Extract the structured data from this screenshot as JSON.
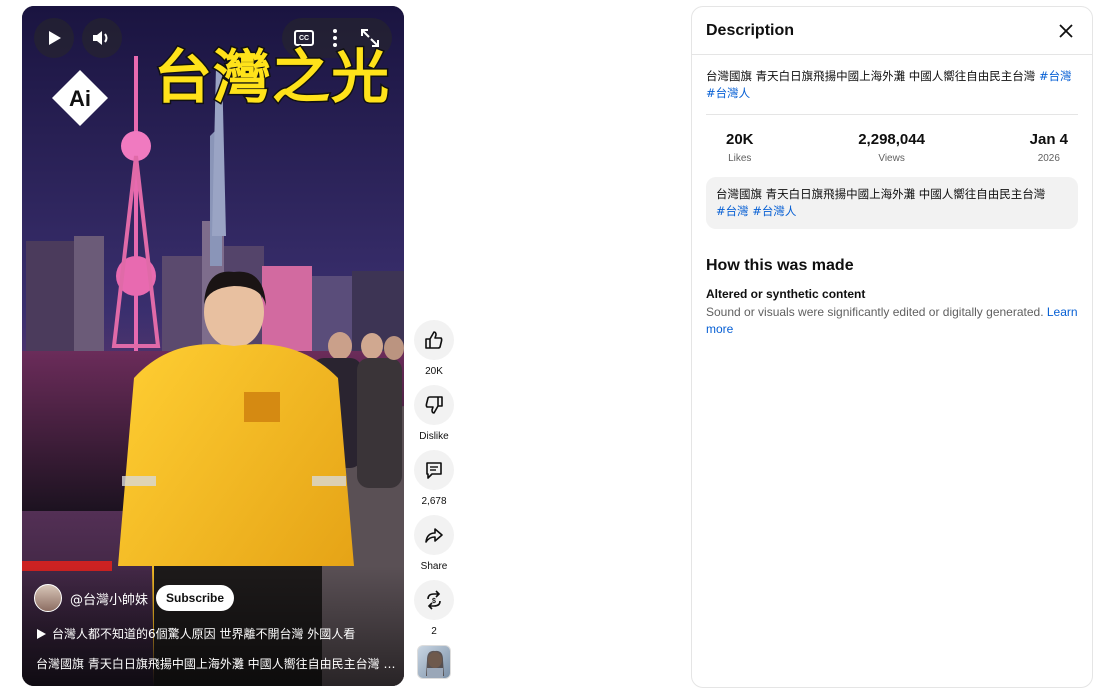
{
  "player": {
    "overlay_title": "台灣之光",
    "ai_badge": "Ai",
    "channel": "@台灣小帥妹",
    "subscribe_label": "Subscribe",
    "related_title": "台灣人都不知道的6個驚人原因 世界離不開台灣 外國人看",
    "caption": "台灣國旗 青天白日旗飛揚中國上海外灘 中國人嚮往自由民主台灣 #...",
    "icons": {
      "play": "play-icon",
      "volume": "volume-icon",
      "cc": "captions-icon",
      "more": "more-vert-icon",
      "fullscreen": "fullscreen-icon"
    }
  },
  "actions": {
    "like_count": "20K",
    "dislike_label": "Dislike",
    "comment_count": "2,678",
    "share_label": "Share",
    "remix_count": "2"
  },
  "description": {
    "title": "Description",
    "text": "台灣國旗 青天白日旗飛揚中國上海外灘 中國人嚮往自由民主台灣 ",
    "tags": [
      "#台灣",
      "#台灣人"
    ],
    "stats": [
      {
        "value": "20K",
        "label": "Likes"
      },
      {
        "value": "2,298,044",
        "label": "Views"
      },
      {
        "value": "Jan 4",
        "label": "2026"
      }
    ],
    "box_text": "台灣國旗 青天白日旗飛揚中國上海外灘 中國人嚮往自由民主台灣",
    "box_tags": [
      "#台灣",
      "#台灣人"
    ],
    "how_made_title": "How this was made",
    "how_made_subtitle": "Altered or synthetic content",
    "how_made_text": "Sound or visuals were significantly edited or digitally generated. ",
    "learn_more": "Learn more"
  },
  "colors": {
    "link": "#065fd4",
    "overlay_text": "#ffe21a",
    "jacket": "#f4b51a"
  }
}
